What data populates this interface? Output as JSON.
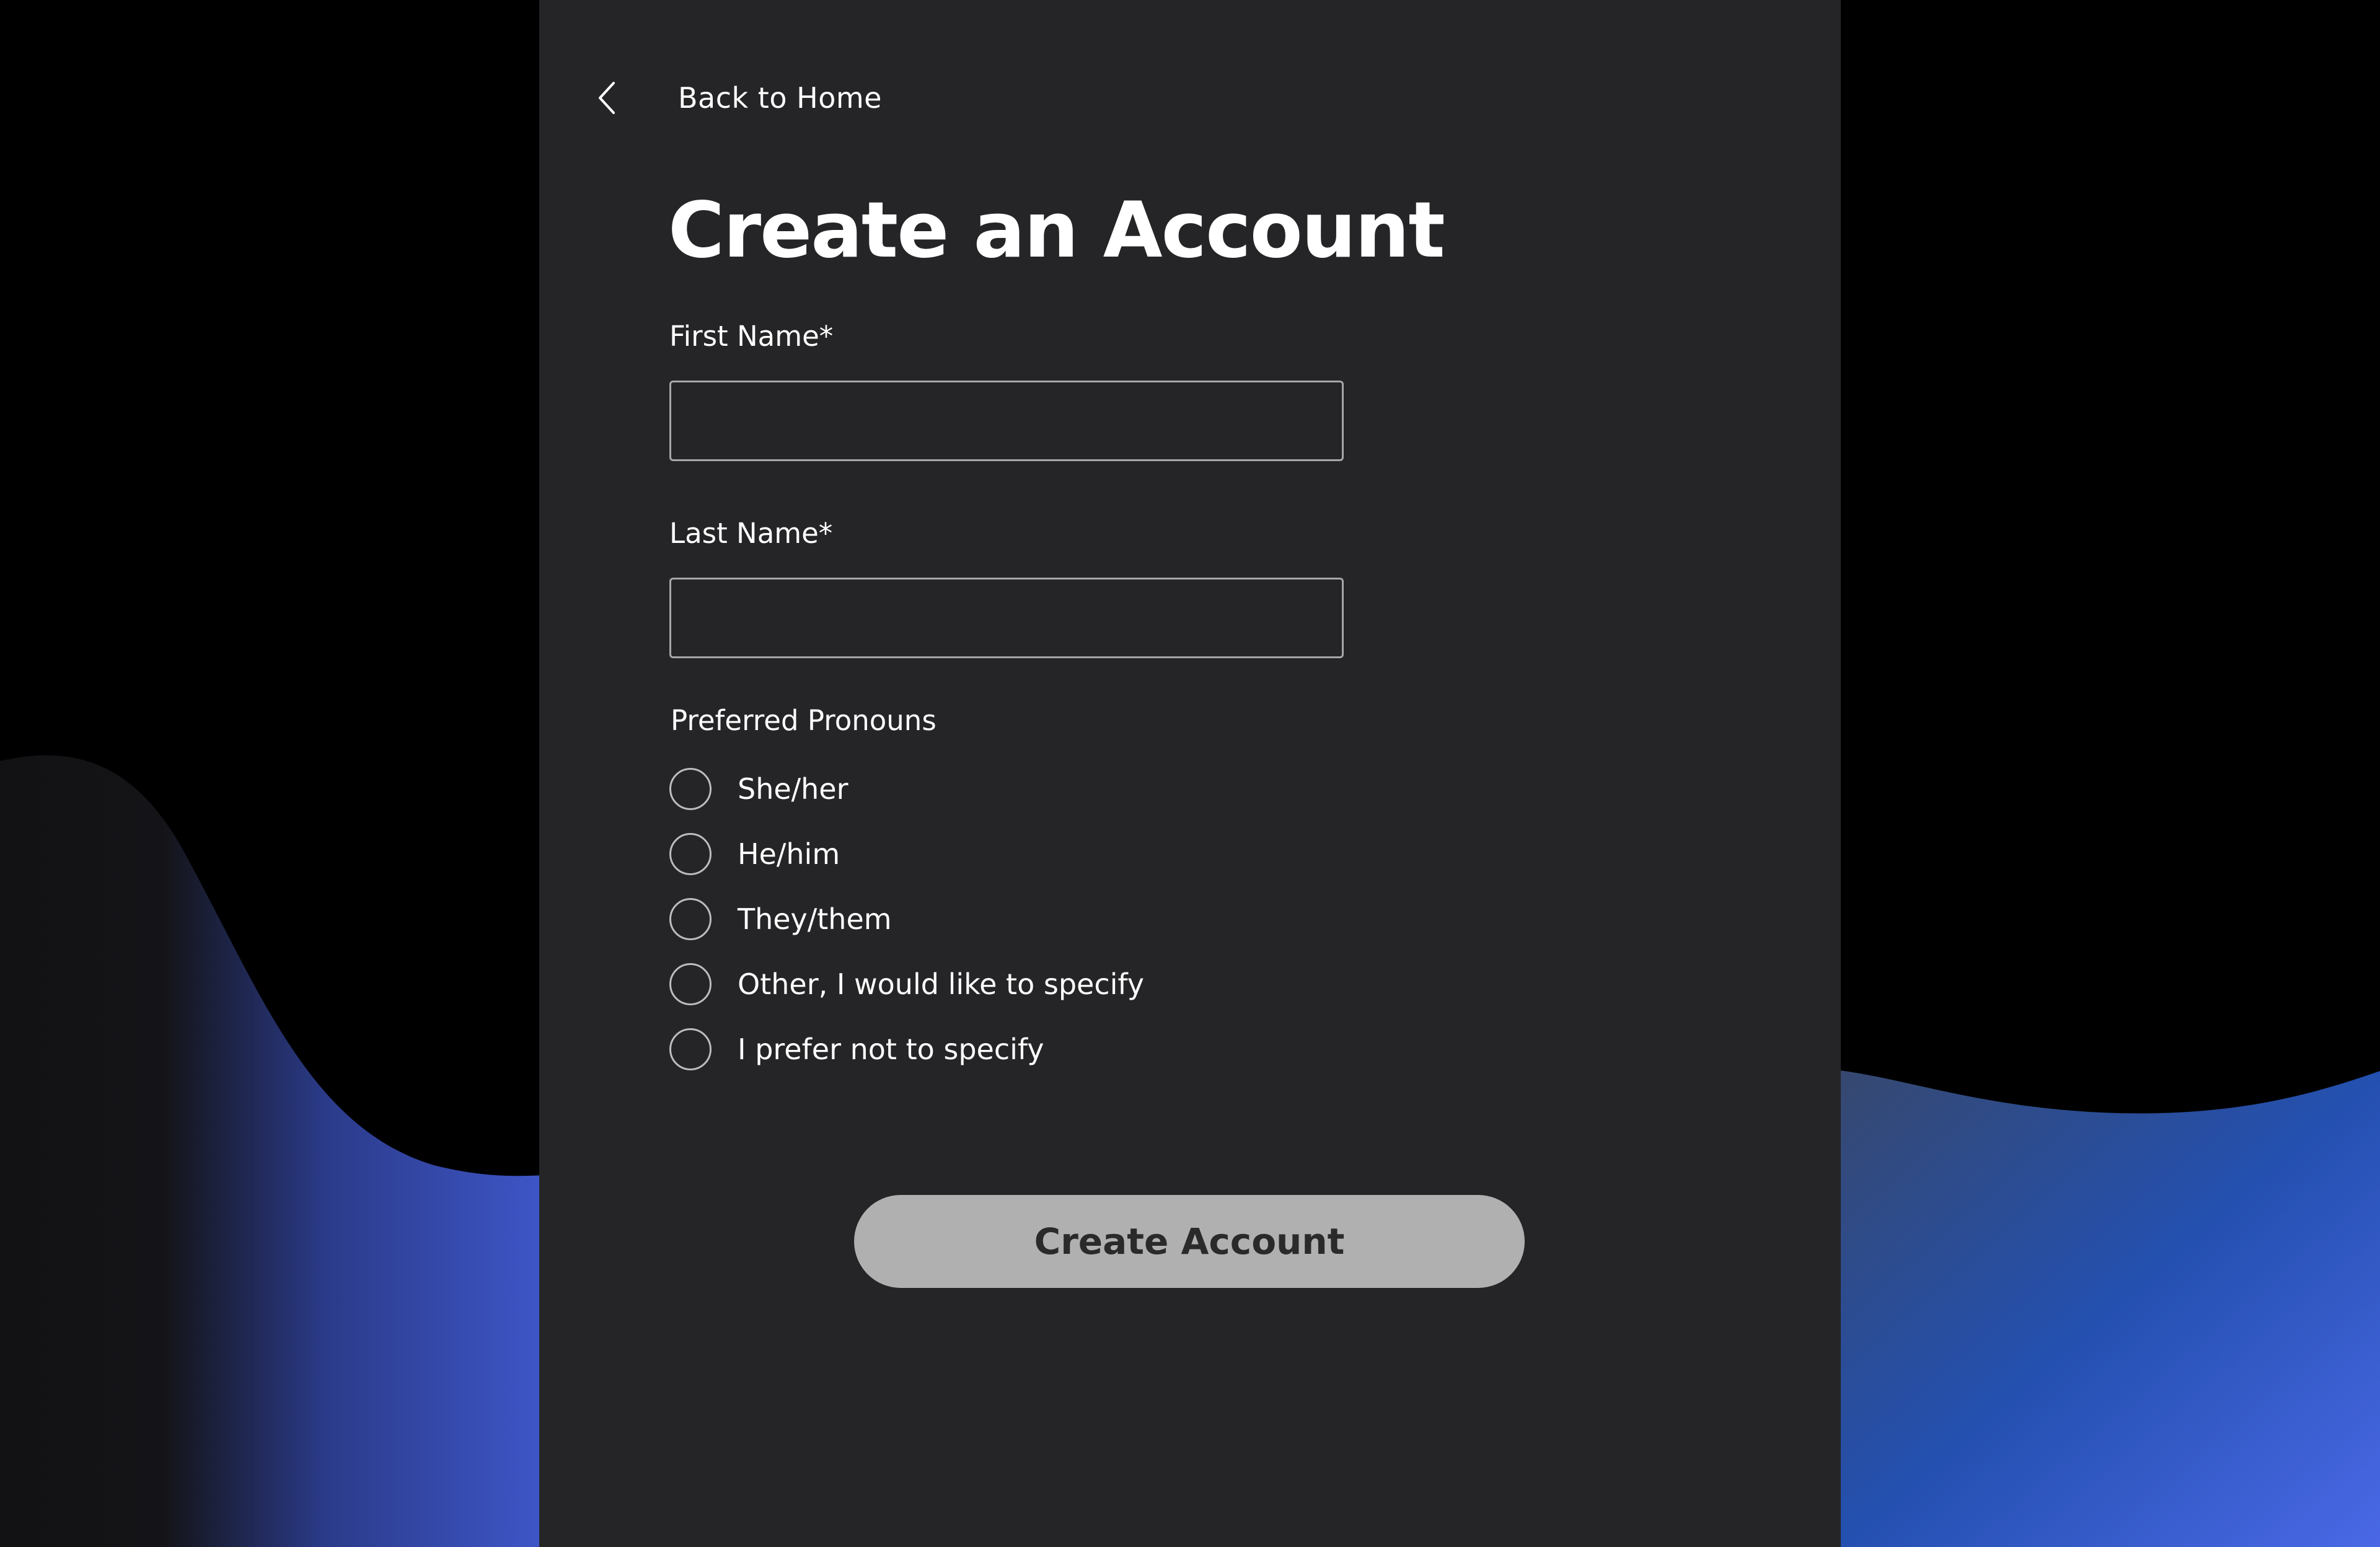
{
  "nav": {
    "back_label": "Back to Home"
  },
  "form": {
    "title": "Create an Account",
    "first_name": {
      "label": "First Name*",
      "value": "",
      "placeholder": ""
    },
    "last_name": {
      "label": "Last Name*",
      "value": "",
      "placeholder": ""
    },
    "pronouns": {
      "label": "Preferred Pronouns",
      "options": [
        {
          "label": "She/her",
          "selected": false
        },
        {
          "label": "He/him",
          "selected": false
        },
        {
          "label": "They/them",
          "selected": false
        },
        {
          "label": "Other, I would like to specify",
          "selected": false
        },
        {
          "label": "I prefer not to specify",
          "selected": false
        }
      ]
    },
    "submit_label": "Create Account"
  },
  "colors": {
    "page_background": "#000000",
    "panel_background": "#252527",
    "wave_blue": "#3b5bd6",
    "button_background": "#b0b0b0",
    "button_text": "#2a2a2a",
    "text": "#ffffff"
  }
}
